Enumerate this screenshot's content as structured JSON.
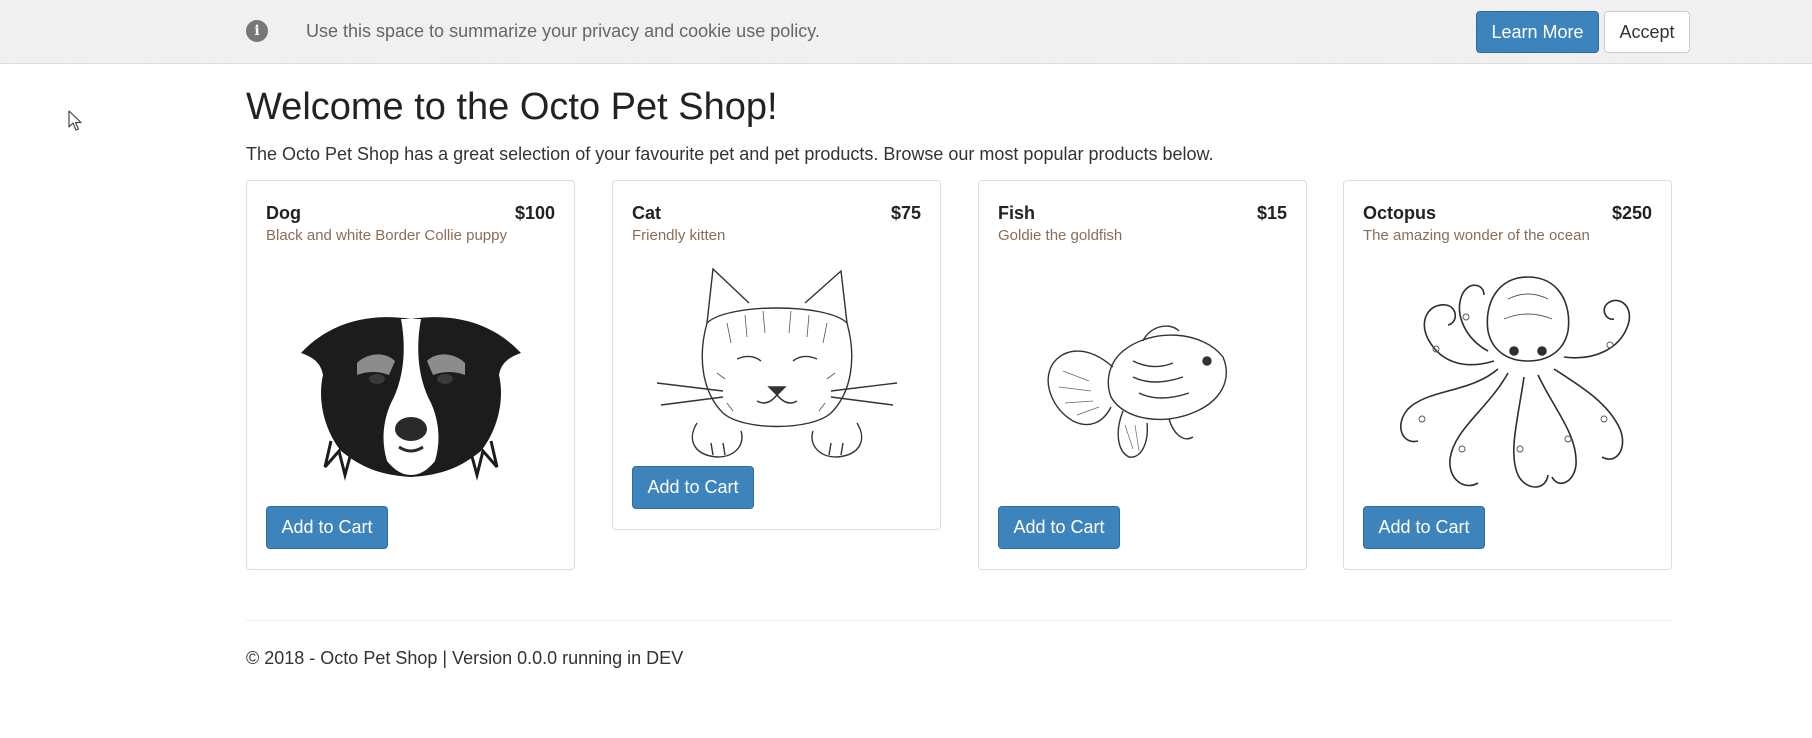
{
  "cookie_banner": {
    "icon": "info-icon",
    "text": "Use this space to summarize your privacy and cookie use policy.",
    "learn_more_label": "Learn More",
    "accept_label": "Accept"
  },
  "main": {
    "title": "Welcome to the Octo Pet Shop!",
    "intro": "The Octo Pet Shop has a great selection of your favourite pet and pet products. Browse our most popular products below."
  },
  "products": [
    {
      "name": "Dog",
      "price": "$100",
      "description": "Black and white Border Collie puppy",
      "image": "dog-illustration",
      "button_label": "Add to Cart"
    },
    {
      "name": "Cat",
      "price": "$75",
      "description": "Friendly kitten",
      "image": "cat-illustration",
      "button_label": "Add to Cart"
    },
    {
      "name": "Fish",
      "price": "$15",
      "description": "Goldie the goldfish",
      "image": "fish-illustration",
      "button_label": "Add to Cart"
    },
    {
      "name": "Octopus",
      "price": "$250",
      "description": "The amazing wonder of the ocean",
      "image": "octopus-illustration",
      "button_label": "Add to Cart"
    }
  ],
  "footer": {
    "text": "© 2018 - Octo Pet Shop | Version 0.0.0 running in DEV"
  },
  "colors": {
    "primary_button": "#3d84bd",
    "banner_background": "#f2f2f2",
    "description_text": "#8a6d57"
  }
}
